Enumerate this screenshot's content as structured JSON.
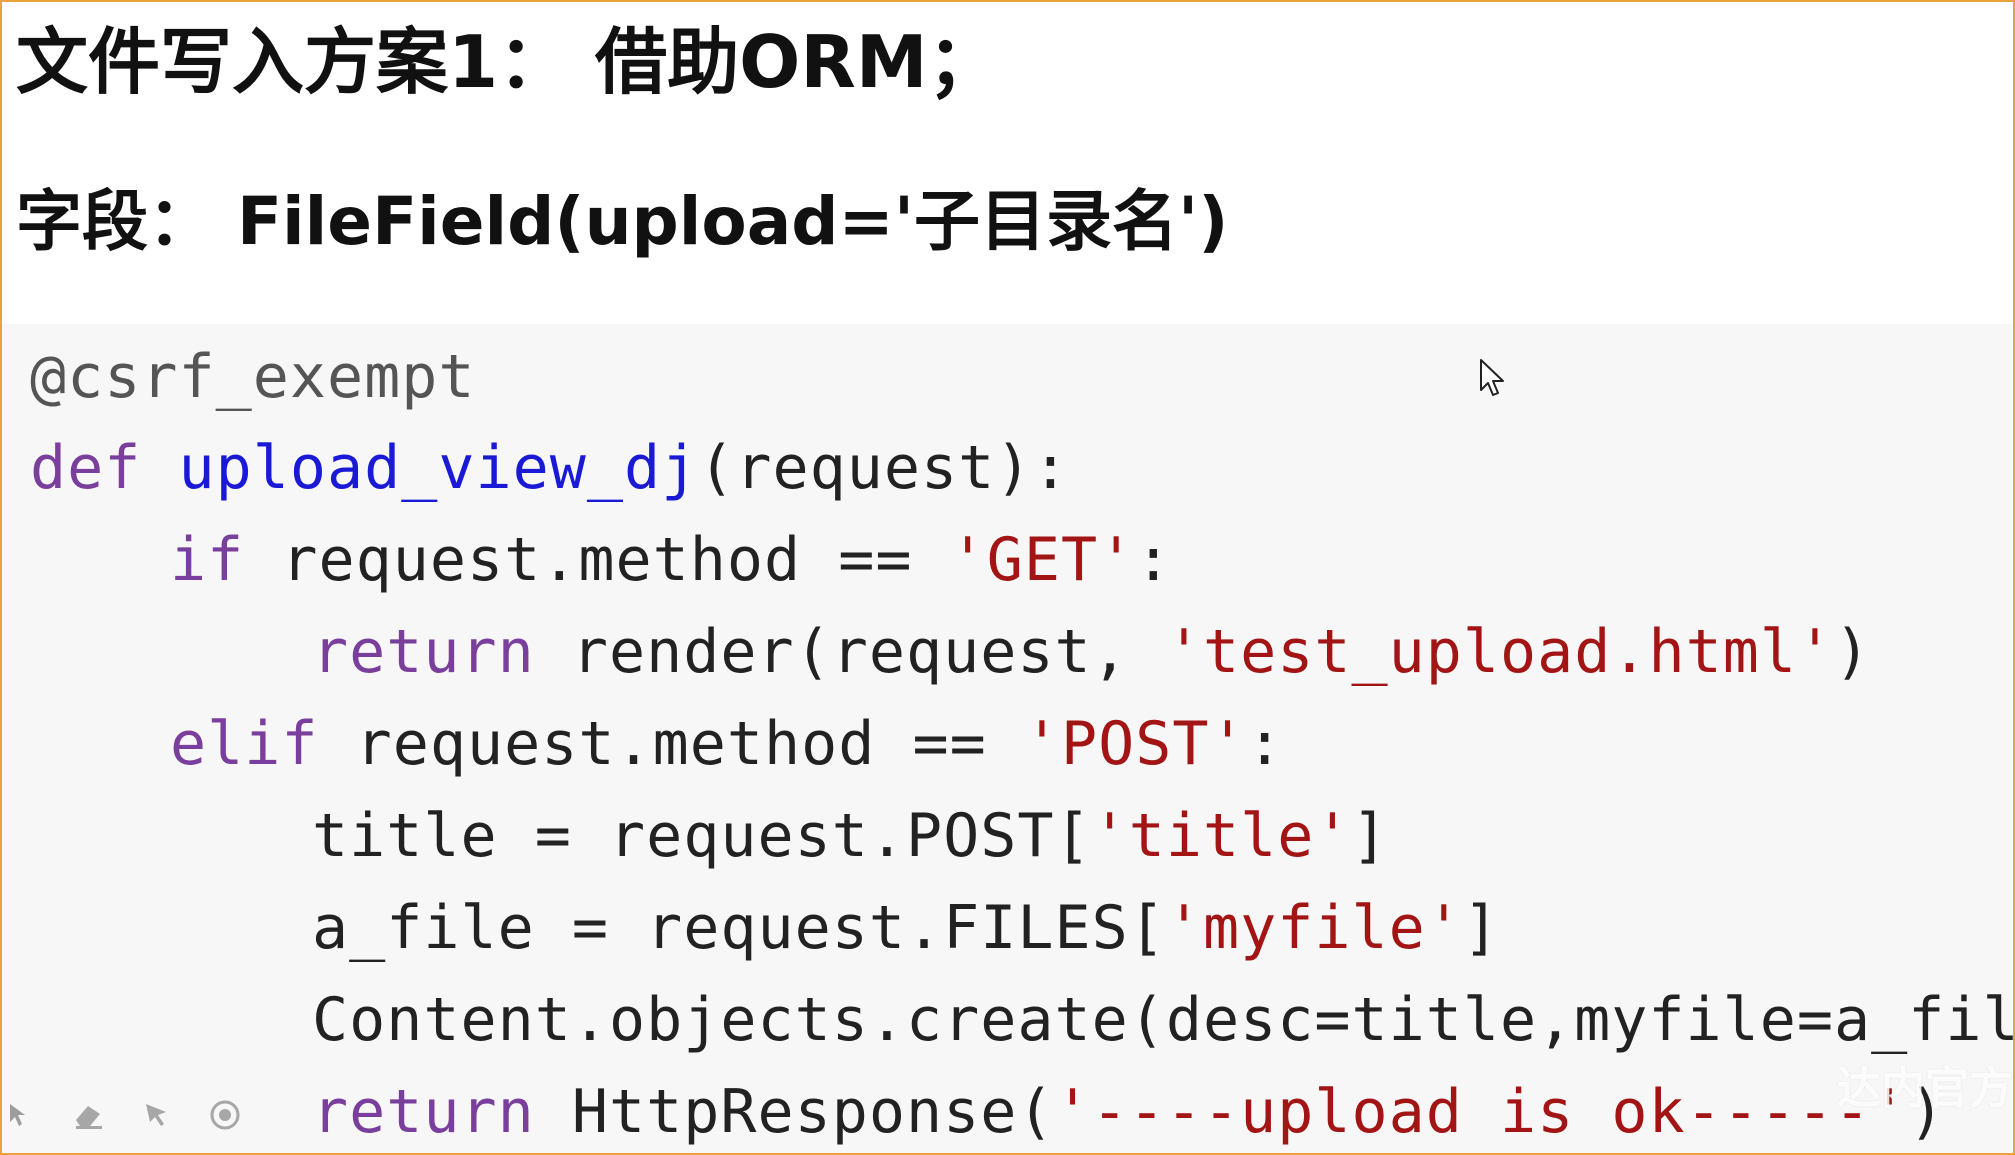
{
  "slide": {
    "heading": "文件写入方案1： 借助ORM；",
    "subheading": "字段： FileField(upload='子目录名')"
  },
  "code": {
    "line1": {
      "decorator": "@csrf_exempt"
    },
    "line2": {
      "kw": "def ",
      "fname": "upload_view_dj",
      "rest": "(request):"
    },
    "line3": {
      "kw": "if",
      "rest": " request.method == ",
      "str": "'GET'",
      "end": ":"
    },
    "line4": {
      "kw": "return",
      "rest": " render(request, ",
      "str": "'test_upload.html'",
      "end": ")"
    },
    "line5": {
      "kw": "elif",
      "rest": " request.method == ",
      "str": "'POST'",
      "end": ":"
    },
    "line6": {
      "rest": "title = request.POST[",
      "str": "'title'",
      "end": "]"
    },
    "line7": {
      "rest": "a_file = request.FILES[",
      "str": "'myfile'",
      "end": "]"
    },
    "line8": {
      "rest": "Content.objects.create(desc=title,myfile=a_file)"
    },
    "line9": {
      "kw": "return",
      "rest": " HttpResponse(",
      "str": "'----upload is ok-----'",
      "end": ")"
    }
  },
  "watermark": "达内官方",
  "icons": {
    "cursor": "mouse-pointer-icon",
    "tools": [
      "arrow-icon",
      "eraser-icon",
      "pointer-icon",
      "record-icon"
    ]
  },
  "colors": {
    "frame_border": "#e8a33c",
    "code_bg": "#f7f7f7",
    "keyword": "#7a3e9d",
    "function": "#1a1ad6",
    "string": "#a31515",
    "decorator": "#555555"
  }
}
